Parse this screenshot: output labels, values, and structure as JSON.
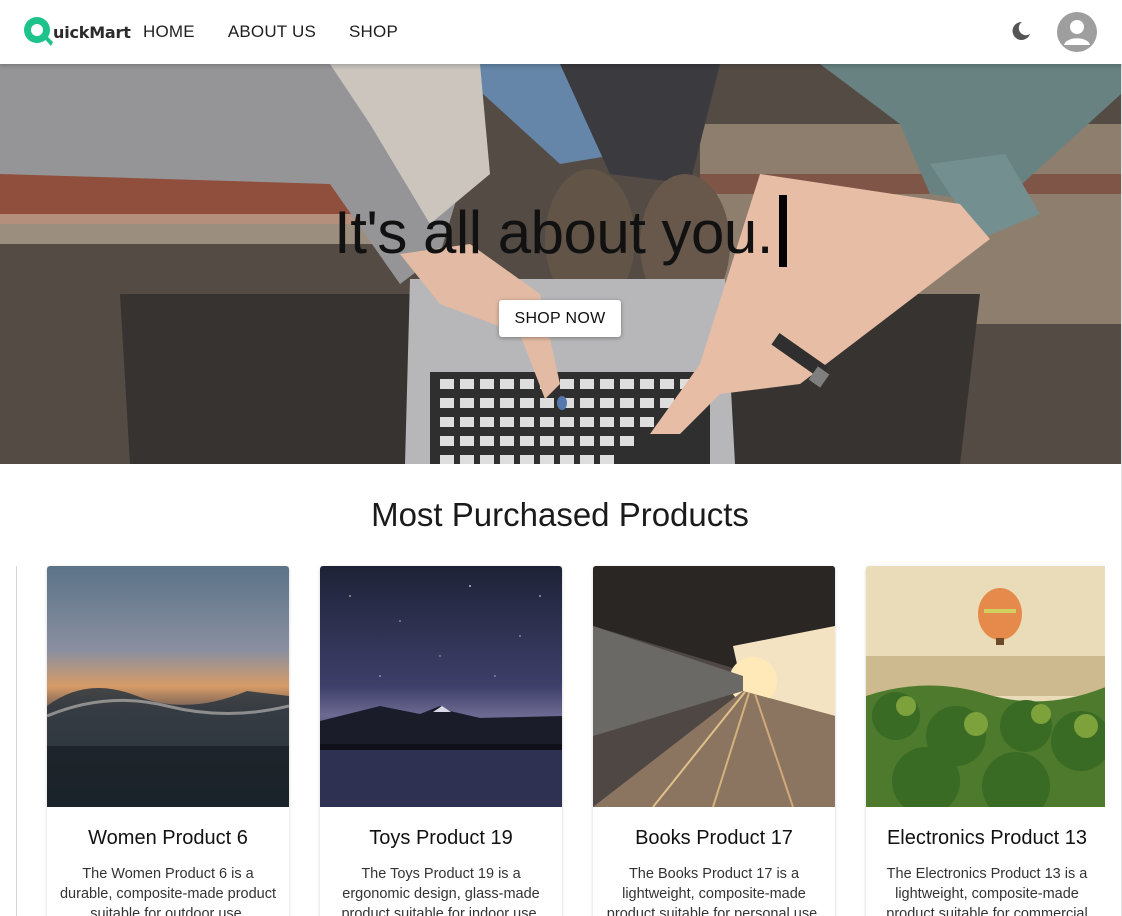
{
  "brand": {
    "name": "uickMart"
  },
  "nav": {
    "items": [
      "HOME",
      "ABOUT US",
      "SHOP"
    ]
  },
  "hero": {
    "headline": "It's all about you.",
    "cta_label": "SHOP NOW"
  },
  "section": {
    "title": "Most Purchased Products"
  },
  "products": [
    {
      "title": "Women Product 6",
      "description": "The Women Product 6 is a durable, composite-made product suitable for outdoor use.",
      "image": "ocean-sunset"
    },
    {
      "title": "Toys Product 19",
      "description": "The Toys Product 19 is a ergonomic design, glass-made product suitable for indoor use.",
      "image": "mountain-lake-night"
    },
    {
      "title": "Books Product 17",
      "description": "The Books Product 17 is a lightweight, composite-made product suitable for personal use.",
      "image": "train-station-sunset"
    },
    {
      "title": "Electronics Product 13",
      "description": "The Electronics Product 13 is a lightweight, composite-made product suitable for commercial use.",
      "image": "hot-air-balloon-palms"
    }
  ],
  "icons": {
    "theme": "moon-icon",
    "account": "account-circle-icon"
  },
  "colors": {
    "brand_accent": "#1ec28b",
    "avatar_bg": "#9e9e9e"
  }
}
